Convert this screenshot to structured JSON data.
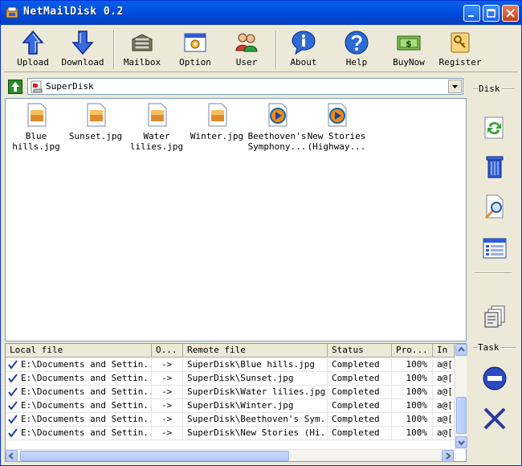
{
  "window": {
    "title": "NetMailDisk  0.2"
  },
  "toolbar": {
    "upload": "Upload",
    "download": "Download",
    "mailbox": "Mailbox",
    "option": "Option",
    "user": "User",
    "about": "About",
    "help": "Help",
    "buynow": "BuyNow",
    "register": "Register"
  },
  "address": {
    "value": "SuperDisk"
  },
  "files": [
    {
      "name": "Blue\nhills.jpg",
      "type": "image"
    },
    {
      "name": "Sunset.jpg",
      "type": "image"
    },
    {
      "name": "Water\nlilies.jpg",
      "type": "image"
    },
    {
      "name": "Winter.jpg",
      "type": "image"
    },
    {
      "name": "Beethoven's\nSymphony...",
      "type": "media"
    },
    {
      "name": "New Stories\n(Highway...",
      "type": "media"
    }
  ],
  "transfers": {
    "columns": [
      "Local file",
      "O...",
      "Remote file",
      "Status",
      "Pro...",
      "In"
    ],
    "rows": [
      {
        "local": "E:\\Documents and Settin...",
        "op": "->",
        "remote": "SuperDisk\\Blue hills.jpg",
        "status": "Completed",
        "progress": "100%",
        "info": "a@["
      },
      {
        "local": "E:\\Documents and Settin...",
        "op": "->",
        "remote": "SuperDisk\\Sunset.jpg",
        "status": "Completed",
        "progress": "100%",
        "info": "a@["
      },
      {
        "local": "E:\\Documents and Settin...",
        "op": "->",
        "remote": "SuperDisk\\Water lilies.jpg",
        "status": "Completed",
        "progress": "100%",
        "info": "a@["
      },
      {
        "local": "E:\\Documents and Settin...",
        "op": "->",
        "remote": "SuperDisk\\Winter.jpg",
        "status": "Completed",
        "progress": "100%",
        "info": "a@["
      },
      {
        "local": "E:\\Documents and Settin...",
        "op": "->",
        "remote": "SuperDisk\\Beethoven's Sym...",
        "status": "Completed",
        "progress": "100%",
        "info": "a@["
      },
      {
        "local": "E:\\Documents and Settin...",
        "op": "->",
        "remote": "SuperDisk\\New Stories (Hi...",
        "status": "Completed",
        "progress": "100%",
        "info": "a@["
      }
    ]
  },
  "panels": {
    "disk": "Disk",
    "task": "Task"
  },
  "icons": {
    "app": "app-icon",
    "upload": "upload-arrow-icon",
    "download": "download-arrow-icon",
    "mailbox": "mailbox-icon",
    "option": "option-window-icon",
    "user": "users-icon",
    "about": "info-icon",
    "help": "help-icon",
    "buynow": "money-icon",
    "register": "key-icon",
    "refresh": "refresh-icon",
    "delete": "trash-icon",
    "search": "magnifier-icon",
    "properties": "properties-icon",
    "copy": "copy-docs-icon",
    "stop": "stop-icon",
    "cancel": "cancel-x-icon"
  },
  "colors": {
    "title_bar": "#0054e3",
    "face": "#ece9d8",
    "accent_blue": "#1e4fbf",
    "check": "#1e3fa8"
  }
}
